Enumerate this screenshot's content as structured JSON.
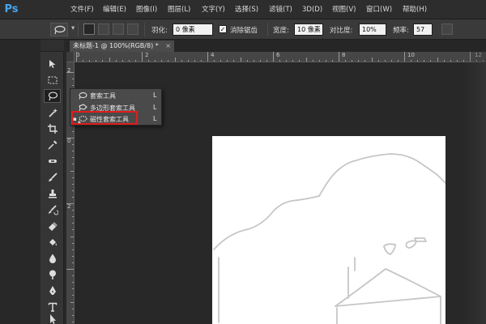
{
  "app": {
    "logo_text": "Ps"
  },
  "menu": [
    {
      "id": "file",
      "label": "文件(F)"
    },
    {
      "id": "edit",
      "label": "编辑(E)"
    },
    {
      "id": "image",
      "label": "图像(I)"
    },
    {
      "id": "layer",
      "label": "图层(L)"
    },
    {
      "id": "type",
      "label": "文字(Y)"
    },
    {
      "id": "select",
      "label": "选择(S)"
    },
    {
      "id": "filter",
      "label": "滤镜(T)"
    },
    {
      "id": "3d",
      "label": "3D(D)"
    },
    {
      "id": "view",
      "label": "视图(V)"
    },
    {
      "id": "window",
      "label": "窗口(W)"
    },
    {
      "id": "help",
      "label": "帮助(H)"
    }
  ],
  "options": {
    "feather_label": "羽化:",
    "feather_value": "0 像素",
    "antialias_label": "消除锯齿",
    "antialias_checked": "✓",
    "width_label": "宽度:",
    "width_value": "10 像素",
    "contrast_label": "对比度:",
    "contrast_value": "10%",
    "frequency_label": "频率:",
    "frequency_value": "57"
  },
  "document": {
    "tab_title": "未标题-1 @ 100%(RGB/8) *",
    "close_glyph": "×"
  },
  "ruler": {
    "top_labels": [
      "0",
      "2",
      "4",
      "6",
      "8",
      "10",
      "12"
    ],
    "left_labels": [
      "2",
      "0",
      "2"
    ]
  },
  "flyout": {
    "items": [
      {
        "label": "套索工具",
        "key": "L",
        "bullet": ""
      },
      {
        "label": "多边形套索工具",
        "key": "L",
        "bullet": ""
      },
      {
        "label": "磁性套索工具",
        "key": "L",
        "bullet": "▪"
      }
    ]
  },
  "colors": {
    "accent_ps": "#45a6f0",
    "highlight_red": "#e11c1c",
    "canvas_white": "#ffffff",
    "workspace": "#282828"
  },
  "tools": [
    "move-tool-icon",
    "marquee-tool-icon",
    "lasso-tool-icon",
    "magic-wand-tool-icon",
    "crop-tool-icon",
    "eyedropper-tool-icon",
    "spot-healing-tool-icon",
    "brush-tool-icon",
    "clone-stamp-tool-icon",
    "history-brush-tool-icon",
    "eraser-tool-icon",
    "paint-bucket-tool-icon",
    "blur-tool-icon",
    "dodge-tool-icon",
    "pen-tool-icon",
    "type-tool-icon",
    "path-selection-tool-icon"
  ]
}
